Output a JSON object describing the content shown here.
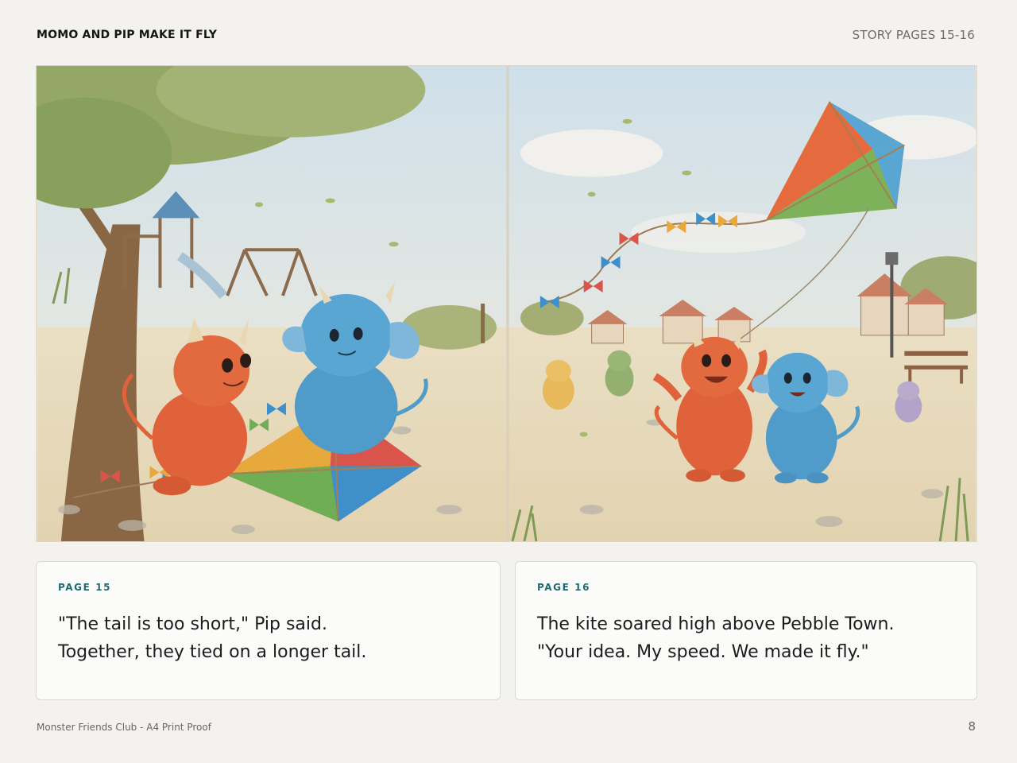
{
  "header": {
    "title": "MOMO AND PIP MAKE IT FLY",
    "pages_label": "STORY PAGES 15-16"
  },
  "pages": [
    {
      "label": "PAGE 15",
      "lines": [
        "\"The tail is too short,\" Pip said.",
        "Together, they tied on a longer tail."
      ]
    },
    {
      "label": "PAGE 16",
      "lines": [
        "The kite soared high above Pebble Town.",
        "\"Your idea. My speed. We made it fly.\""
      ]
    }
  ],
  "footer": {
    "left": "Monster Friends Club - A4 Print Proof",
    "page_number": "8"
  },
  "colors": {
    "accent": "#1e6b74",
    "momo_orange": "#e0623a",
    "pip_blue": "#4f9ccb"
  }
}
